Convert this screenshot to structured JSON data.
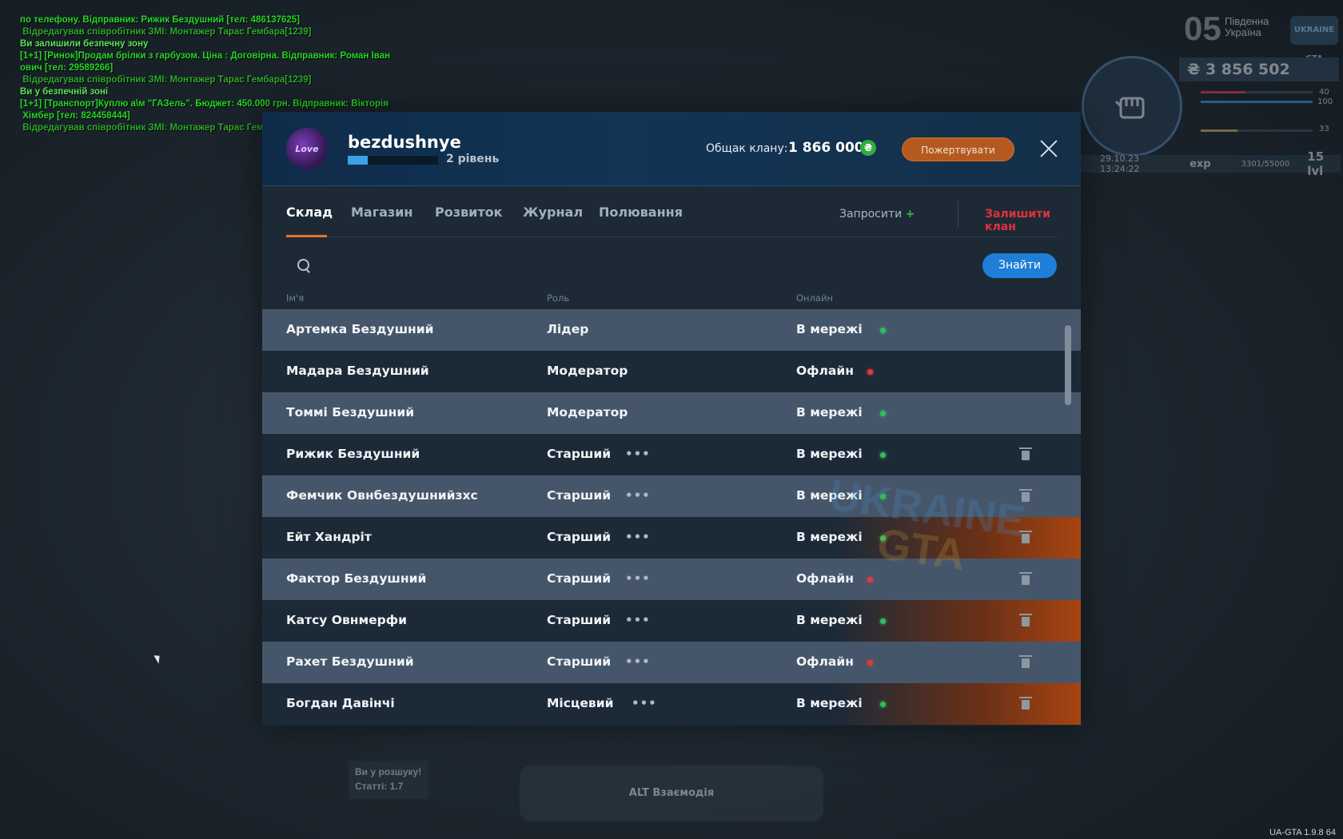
{
  "chat": [
    {
      "text": "по телефону. Відправник: Рижик Бездушний [тел: 486137625]",
      "color": "#26d526"
    },
    {
      "text": " Відредагував співробітник ЗМІ: Монтажер Тарас Гембара[1239]",
      "color": "#2fa82f"
    },
    {
      "text": "Ви залишили безпечну зону",
      "color": "#5ae65a"
    },
    {
      "text": "[1+1] [Ринок]Продам брілки з гарбузом. Ціна : Договірна. Відправник: Роман Іван",
      "color": "#26d526"
    },
    {
      "text": "ович [тел: 29589266]",
      "color": "#26d526"
    },
    {
      "text": " Відредагував співробітник ЗМІ: Монтажер Тарас Гембара[1239]",
      "color": "#2fa82f"
    },
    {
      "text": "Ви у безпечній зоні",
      "color": "#5ae65a"
    },
    {
      "text": "[1+1] [Транспорт]Куплю а\\м \"ГАЗель\". Бюджет: 450.000 грн. Відправник: Вікторія",
      "color": "#26d526"
    },
    {
      "text": " Хімбер [тел: 824458444]",
      "color": "#26d526"
    },
    {
      "text": " Відредагував співробітник ЗМІ: Монтажер Тарас Гембара[1239]",
      "color": "#2fa82f"
    }
  ],
  "hud": {
    "zone_number": "05",
    "zone_name": "Південна Україна",
    "logo_text": "UKRAINE GTA",
    "money": "₴ 3 856 502",
    "health": "40",
    "armor": "100",
    "fuel": "33",
    "datetime": "29.10.23 13:24:22",
    "exp_label": "exp",
    "exp_value": "3301/55000",
    "level": "15 lvl",
    "health_fill": 0.4,
    "armor_fill": 1.0,
    "fuel_fill": 0.33
  },
  "clan": {
    "logo_text": "Love",
    "name": "bezdushnye",
    "level_text": "2 рівень",
    "level_progress": 0.22,
    "bank_label": "Общак клану:",
    "bank_value": "1 866 000",
    "bank_icon": "₴",
    "donate_label": "Пожертвувати"
  },
  "tabs": [
    "Склад",
    "Магазин",
    "Розвиток",
    "Журнал",
    "Полювання"
  ],
  "actions": {
    "invite_label": "Запросити",
    "invite_plus": "+",
    "leave_label": "Залишити клан"
  },
  "search": {
    "placeholder": "",
    "button_label": "Знайти"
  },
  "columns": {
    "name": "Ім'я",
    "role": "Роль",
    "online": "Онлайн"
  },
  "members": [
    {
      "name": "Артемка Бездушний",
      "role": "Лідер",
      "status": "В мережі",
      "online": true,
      "menu": false,
      "trash": false,
      "shade": "light",
      "glow": false
    },
    {
      "name": "Мадара Бездушний",
      "role": "Модератор",
      "status": "Офлайн",
      "online": false,
      "menu": false,
      "trash": false,
      "shade": "dark",
      "glow": false
    },
    {
      "name": "Томмі Бездушний",
      "role": "Модератор",
      "status": "В мережі",
      "online": true,
      "menu": false,
      "trash": false,
      "shade": "light",
      "glow": false
    },
    {
      "name": "Рижик Бездушний",
      "role": "Старший",
      "status": "В мережі",
      "online": true,
      "menu": true,
      "trash": true,
      "shade": "dark",
      "glow": false
    },
    {
      "name": "Фемчик Овнбездушнийзхс",
      "role": "Старший",
      "status": "В мережі",
      "online": true,
      "menu": true,
      "trash": true,
      "shade": "light",
      "glow": false
    },
    {
      "name": "Ейт Хандріт",
      "role": "Старший",
      "status": "В мережі",
      "online": true,
      "menu": true,
      "trash": true,
      "shade": "dark",
      "glow": true
    },
    {
      "name": "Фактор Бездушний",
      "role": "Старший",
      "status": "Офлайн",
      "online": false,
      "menu": true,
      "trash": true,
      "shade": "light",
      "glow": false
    },
    {
      "name": "Катсу Овнмерфи",
      "role": "Старший",
      "status": "В мережі",
      "online": true,
      "menu": true,
      "trash": true,
      "shade": "dark",
      "glow": true
    },
    {
      "name": "Рахет Бездушний",
      "role": "Старший",
      "status": "Офлайн",
      "online": false,
      "menu": true,
      "trash": true,
      "shade": "light",
      "glow": false
    },
    {
      "name": "Богдан Давінчі",
      "role": "Місцевий",
      "status": "В мережі",
      "online": true,
      "menu": true,
      "trash": true,
      "shade": "dark",
      "glow": true
    }
  ],
  "bottom": {
    "wanted_title": "Ви у розшуку!",
    "wanted_articles": "Статті: 1.7",
    "interaction": "ALT Взаємодія",
    "version": "UA-GTA 1.9.8 64"
  },
  "colors": {
    "accent_orange": "#e4742a",
    "accent_blue": "#1f7fd8",
    "online_green": "#2fbe5a",
    "offline_red": "#e03a3a",
    "leave_red": "#e0323a"
  }
}
